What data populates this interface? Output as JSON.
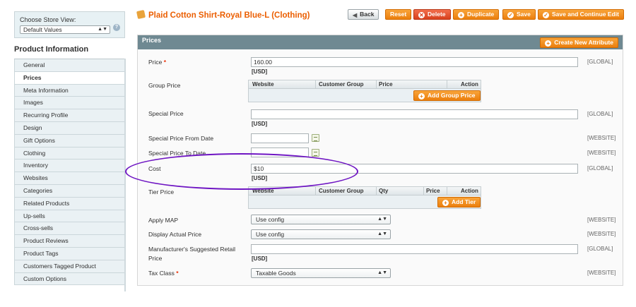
{
  "store_view": {
    "label": "Choose Store View:",
    "selected": "Default Values"
  },
  "sidebar": {
    "title": "Product Information",
    "items": [
      {
        "label": "General",
        "active": false
      },
      {
        "label": "Prices",
        "active": true
      },
      {
        "label": "Meta Information",
        "active": false
      },
      {
        "label": "Images",
        "active": false
      },
      {
        "label": "Recurring Profile",
        "active": false
      },
      {
        "label": "Design",
        "active": false
      },
      {
        "label": "Gift Options",
        "active": false
      },
      {
        "label": "Clothing",
        "active": false
      },
      {
        "label": "Inventory",
        "active": false
      },
      {
        "label": "Websites",
        "active": false
      },
      {
        "label": "Categories",
        "active": false
      },
      {
        "label": "Related Products",
        "active": false
      },
      {
        "label": "Up-sells",
        "active": false
      },
      {
        "label": "Cross-sells",
        "active": false
      },
      {
        "label": "Product Reviews",
        "active": false
      },
      {
        "label": "Product Tags",
        "active": false
      },
      {
        "label": "Customers Tagged Product",
        "active": false
      },
      {
        "label": "Custom Options",
        "active": false
      }
    ]
  },
  "header": {
    "title": "Plaid Cotton Shirt-Royal Blue-L (Clothing)",
    "buttons": {
      "back": "Back",
      "reset": "Reset",
      "delete": "Delete",
      "duplicate": "Duplicate",
      "save": "Save",
      "save_continue": "Save and Continue Edit"
    }
  },
  "panel": {
    "title": "Prices",
    "create_attribute": "Create New Attribute",
    "price": {
      "label": "Price",
      "required": "*",
      "value": "160.00",
      "unit": "[USD]",
      "scope": "[GLOBAL]"
    },
    "group_price": {
      "label": "Group Price",
      "columns": [
        "Website",
        "Customer Group",
        "Price",
        "Action"
      ],
      "add_button": "Add Group Price"
    },
    "special_price": {
      "label": "Special Price",
      "value": "",
      "unit": "[USD]",
      "scope": "[GLOBAL]"
    },
    "special_from": {
      "label": "Special Price From Date",
      "value": "",
      "scope": "[WEBSITE]"
    },
    "special_to": {
      "label": "Special Price To Date",
      "value": "",
      "scope": "[WEBSITE]"
    },
    "cost": {
      "label": "Cost",
      "value": "$10",
      "unit": "[USD]",
      "scope": "[GLOBAL]"
    },
    "tier_price": {
      "label": "Tier Price",
      "columns": [
        "Website",
        "Customer Group",
        "Qty",
        "Price",
        "Action"
      ],
      "add_button": "Add Tier"
    },
    "apply_map": {
      "label": "Apply MAP",
      "selected": "Use config",
      "scope": "[WEBSITE]"
    },
    "display_actual_price": {
      "label": "Display Actual Price",
      "selected": "Use config",
      "scope": "[WEBSITE]"
    },
    "msrp": {
      "label_line1": "Manufacturer's Suggested Retail",
      "label_line2": "Price",
      "value": "",
      "unit": "[USD]",
      "scope": "[GLOBAL]"
    },
    "tax_class": {
      "label": "Tax Class",
      "required": "*",
      "selected": "Taxable Goods",
      "scope": "[WEBSITE]"
    }
  },
  "colors": {
    "accent_orange": "#eb5e00",
    "panel_header": "#6f8992",
    "annotation": "#6f16c3"
  }
}
